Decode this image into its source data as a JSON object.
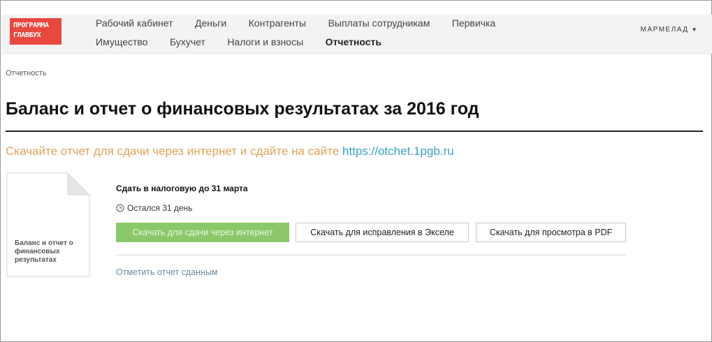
{
  "logo": {
    "line1": "ПРОГРАММА",
    "line2": "ГЛАВБУХ",
    "color": "#e8483f"
  },
  "nav": {
    "row1": [
      "Рабочий кабинет",
      "Деньги",
      "Контрагенты",
      "Выплаты сотрудникам",
      "Первичка"
    ],
    "row2": [
      "Имущество",
      "Бухучет",
      "Налоги и взносы",
      "Отчетность"
    ],
    "active": "Отчетность"
  },
  "user": {
    "name": "МАРМЕЛАД",
    "icon": "chevron-down-icon"
  },
  "breadcrumb": "Отчетность",
  "page": {
    "title": "Баланс и отчет о финансовых результатах за 2016 год",
    "subtitle_text": "Скачайте отчет для сдачи через интернет и сдайте на сайте",
    "subtitle_link": "https://otchet.1pgb.ru"
  },
  "report": {
    "doc_label": "Баланс и отчет о финансовых результатах",
    "deadline": "Сдать в налоговую до 31 марта",
    "remaining": "Остался 31 день",
    "buttons": {
      "internet": "Скачать для сдачи через интернет",
      "excel": "Скачать для исправления в Экселе",
      "pdf": "Скачать для просмотра в PDF"
    },
    "mark_done": "Отметить отчет сданным"
  },
  "colors": {
    "accent_green": "#8bc86a",
    "subtitle_orange": "#e0a25a",
    "link_blue": "#3aa0c8"
  }
}
